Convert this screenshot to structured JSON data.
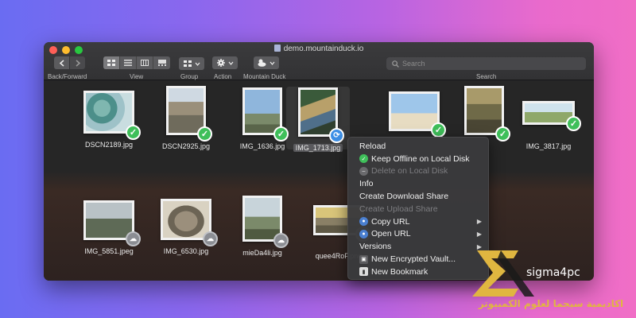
{
  "window": {
    "title": "demo.mountainduck.io"
  },
  "toolbar": {
    "back_forward_label": "Back/Forward",
    "view_label": "View",
    "group_label": "Group",
    "action_label": "Action",
    "mountain_duck_label": "Mountain Duck",
    "search_label": "Search",
    "search_placeholder": "Search"
  },
  "files": [
    {
      "name": "DSCN2189.jpg",
      "status": "check-icon"
    },
    {
      "name": "DSCN2925.jpg",
      "status": "check-icon"
    },
    {
      "name": "IMG_1636.jpg",
      "status": "check-icon"
    },
    {
      "name": "IMG_1713.jpg",
      "status": "sync-icon",
      "selected": true
    },
    {
      "name": "",
      "status": "check-icon"
    },
    {
      "name": "",
      "status": "check-icon"
    },
    {
      "name": "IMG_3817.jpg",
      "status": "check-icon"
    },
    {
      "name": "IMG_5851.jpeg",
      "status": "cloud-icon"
    },
    {
      "name": "IMG_6530.jpg",
      "status": "cloud-icon"
    },
    {
      "name": "mieDa4li.jpg",
      "status": "cloud-icon"
    },
    {
      "name": "quee4RoF.png",
      "status": "cloud-icon"
    }
  ],
  "context_menu": {
    "items": [
      {
        "label": "Reload",
        "enabled": true
      },
      {
        "label": "Keep Offline on Local Disk",
        "enabled": true,
        "icon": "check-circle-icon"
      },
      {
        "label": "Delete on Local Disk",
        "enabled": false,
        "icon": "minus-circle-icon"
      },
      {
        "label": "Info",
        "enabled": true
      },
      {
        "label": "Create Download Share",
        "enabled": true
      },
      {
        "label": "Create Upload Share",
        "enabled": false
      },
      {
        "label": "Copy URL",
        "enabled": true,
        "icon": "globe-icon",
        "submenu": true
      },
      {
        "label": "Open URL",
        "enabled": true,
        "icon": "globe-icon",
        "submenu": true
      },
      {
        "label": "Versions",
        "enabled": true,
        "submenu": true
      },
      {
        "label": "New Encrypted Vault...",
        "enabled": true,
        "icon": "vault-icon"
      },
      {
        "label": "New Bookmark",
        "enabled": true,
        "icon": "bookmark-icon"
      }
    ]
  },
  "brand": {
    "name": "sigma4pc",
    "arabic": "اكاديمية سيجما لعلوم الكمبيوتر"
  },
  "colors": {
    "accent_green": "#3fbf5a",
    "accent_blue": "#3d8fe6",
    "logo_gold": "#e0b640"
  }
}
